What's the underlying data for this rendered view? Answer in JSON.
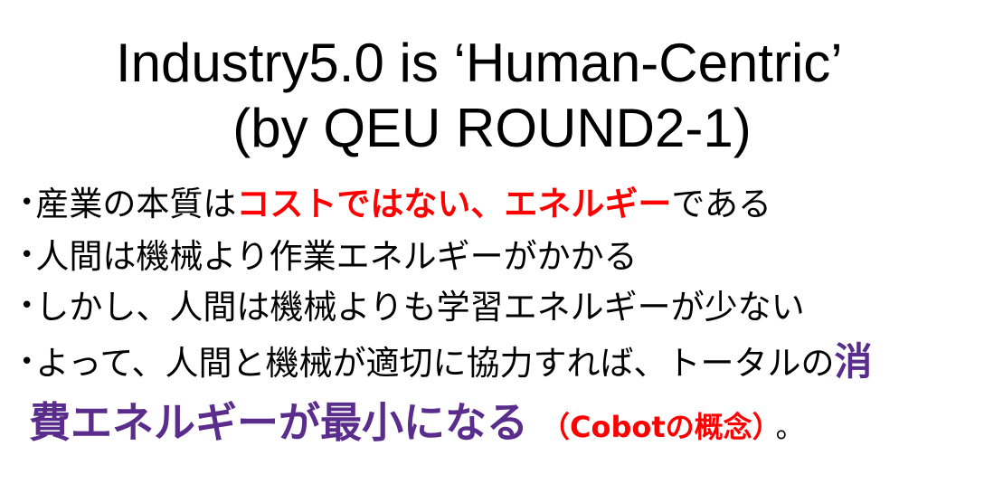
{
  "title": {
    "line1": "Industry5.0 is ‘Human-Centric’",
    "line2": "(by QEU ROUND2-1)"
  },
  "bullets": {
    "marker": "•",
    "b1": {
      "pre": "産業の本質は",
      "highlight": "コストではない、エネルギー",
      "post": "である"
    },
    "b2": {
      "text": "人間は機械より作業エネルギーがかかる"
    },
    "b3": {
      "text": "しかし、人間は機械よりも学習エネルギーが少ない"
    },
    "b4": {
      "pre": "よって、人間と機械が適切に協力すれば、トータルの",
      "highlight_start": "消",
      "highlight_rest": "費エネルギーが最小になる",
      "note": "（Cobotの概念）",
      "period": "。"
    }
  },
  "colors": {
    "highlight_red": "#ff0000",
    "highlight_purple": "#5a2d8c",
    "text": "#000000",
    "background": "#ffffff"
  }
}
